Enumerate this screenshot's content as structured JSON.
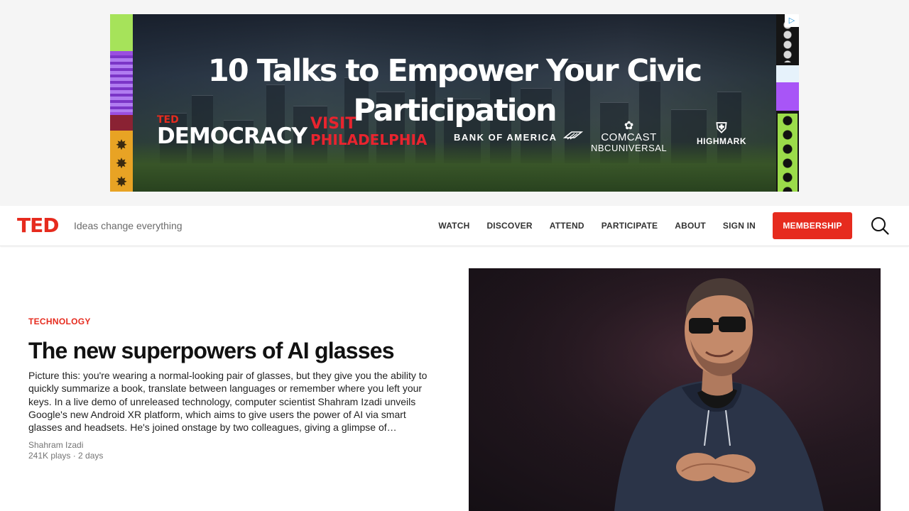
{
  "ad": {
    "headline": "10 Talks to Empower Your Civic Participation",
    "logos": {
      "ted_small": "TED",
      "democracy": "DEMOCRACY",
      "visit_line1": "VISIT",
      "visit_line2": "PHILADELPHIA",
      "bank": "BANK OF AMERICA",
      "comcast_line1": "COMCAST",
      "comcast_line2": "NBCUNIVERSAL",
      "highmark": "HIGHMARK"
    },
    "colors": {
      "lime": "#a6e35a",
      "purple": "#9a4fe0",
      "orange": "#e8a324",
      "visit_red": "#e8242e"
    }
  },
  "header": {
    "logo_text": "TED",
    "tagline": "Ideas change everything",
    "nav": [
      {
        "label": "WATCH"
      },
      {
        "label": "DISCOVER"
      },
      {
        "label": "ATTEND"
      },
      {
        "label": "PARTICIPATE"
      },
      {
        "label": "ABOUT"
      },
      {
        "label": "SIGN IN"
      }
    ],
    "membership_label": "MEMBERSHIP",
    "search_icon": "search-icon",
    "brand_color": "#e62b1e"
  },
  "hero": {
    "category": "TECHNOLOGY",
    "title": "The new superpowers of AI glasses",
    "description": "Picture this: you're wearing a normal-looking pair of glasses, but they give you the ability to quickly summarize a book, translate between languages or remember where you left your keys. In a live demo of unreleased technology, computer scientist Shahram Izadi unveils Google's new Android XR platform, which aims to give users the power of AI via smart glasses and headsets. He's joined onstage by two colleagues, giving a glimpse of…",
    "speaker": "Shahram Izadi",
    "meta": "241K plays · 2 days",
    "image_alt": "Speaker on stage in a dark hoodie and glasses"
  }
}
